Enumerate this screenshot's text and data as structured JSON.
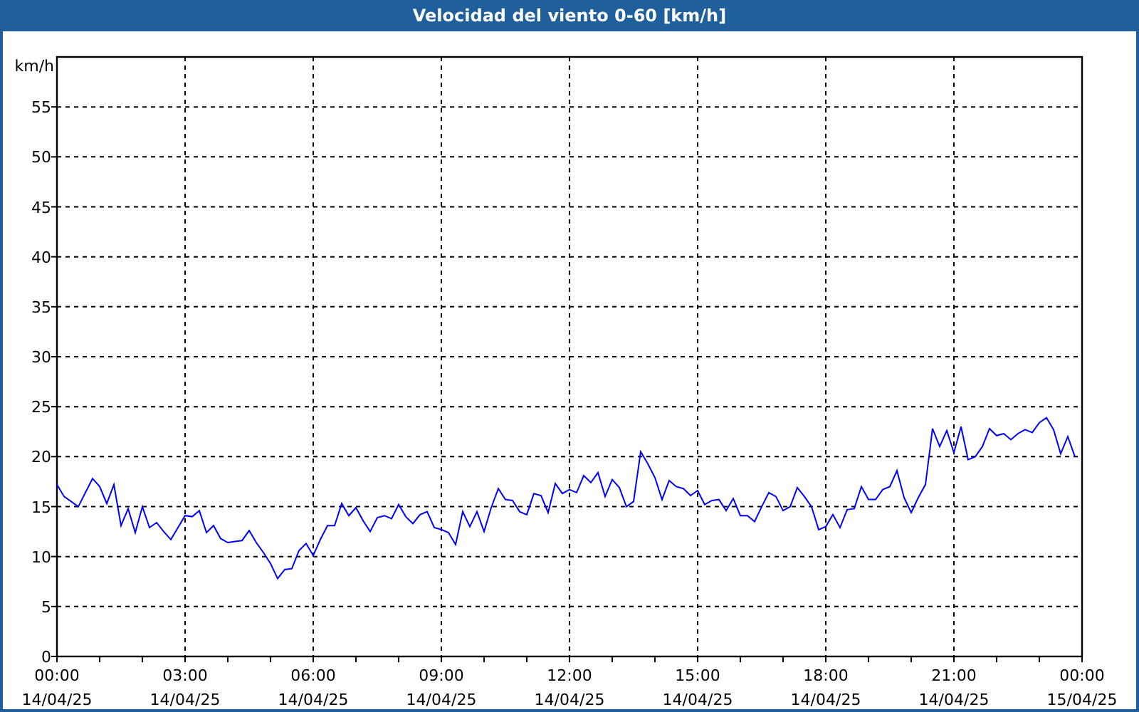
{
  "chart_data": {
    "type": "line",
    "title": "Velocidad del viento 0-60 [km/h]",
    "ylabel": "km/h",
    "categories": [
      "00:00 14/04/25",
      null,
      null,
      null,
      null,
      null,
      null,
      null,
      null,
      null,
      null,
      null,
      null,
      null,
      null,
      null,
      null,
      null,
      "03:00 14/04/25",
      null,
      null,
      null,
      null,
      null,
      null,
      null,
      null,
      null,
      null,
      null,
      null,
      null,
      null,
      null,
      null,
      null,
      "06:00 14/04/25",
      null,
      null,
      null,
      null,
      null,
      null,
      null,
      null,
      null,
      null,
      null,
      null,
      null,
      null,
      null,
      null,
      null,
      "09:00 14/04/25",
      null,
      null,
      null,
      null,
      null,
      null,
      null,
      null,
      null,
      null,
      null,
      null,
      null,
      null,
      null,
      null,
      null,
      "12:00 14/04/25",
      null,
      null,
      null,
      null,
      null,
      null,
      null,
      null,
      null,
      null,
      null,
      null,
      null,
      null,
      null,
      null,
      null,
      "15:00 14/04/25",
      null,
      null,
      null,
      null,
      null,
      null,
      null,
      null,
      null,
      null,
      null,
      null,
      null,
      null,
      null,
      null,
      null,
      "18:00 14/04/25",
      null,
      null,
      null,
      null,
      null,
      null,
      null,
      null,
      null,
      null,
      null,
      null,
      null,
      null,
      null,
      null,
      null,
      "21:00 14/04/25",
      null,
      null,
      null,
      null,
      null,
      null,
      null,
      null,
      null,
      null,
      null,
      null,
      null,
      null,
      null,
      null,
      null,
      "00:00 15/04/25"
    ],
    "series": [
      {
        "color": "#0000ff",
        "values": [
          17.2,
          16.0,
          15.5,
          15.0,
          16.4,
          17.8,
          17.0,
          15.3,
          17.2,
          13.1,
          14.8,
          12.4,
          15.0,
          12.9,
          13.4,
          12.5,
          11.7,
          12.9,
          14.1,
          14.0,
          14.6,
          12.4,
          13.1,
          11.8,
          11.4,
          11.5,
          11.6,
          12.6,
          11.4,
          10.4,
          9.3,
          7.8,
          8.7,
          8.8,
          10.6,
          11.3,
          10.1,
          11.7,
          13.1,
          13.1,
          15.3,
          14.1,
          14.9,
          13.6,
          12.5,
          13.9,
          14.1,
          13.8,
          15.2,
          14.0,
          13.3,
          14.2,
          14.5,
          12.9,
          12.7,
          12.4,
          11.2,
          14.5,
          13.0,
          14.5,
          12.5,
          14.9,
          16.8,
          15.7,
          15.6,
          14.5,
          14.2,
          16.3,
          16.1,
          14.4,
          17.3,
          16.3,
          16.7,
          16.4,
          18.1,
          17.4,
          18.4,
          16.0,
          17.7,
          16.9,
          15.0,
          15.5,
          20.5,
          19.3,
          17.9,
          15.7,
          17.6,
          17.0,
          16.8,
          16.1,
          16.6,
          15.2,
          15.6,
          15.7,
          14.6,
          15.8,
          14.1,
          14.1,
          13.5,
          15.0,
          16.4,
          16.0,
          14.6,
          15.0,
          16.9,
          16.0,
          15.0,
          12.7,
          13.0,
          14.2,
          12.9,
          14.7,
          14.8,
          17.0,
          15.7,
          15.7,
          16.7,
          17.0,
          18.6,
          15.9,
          14.4,
          15.9,
          17.2,
          22.8,
          21.0,
          22.6,
          20.4,
          23.0,
          19.7,
          20.0,
          21.0,
          22.8,
          22.1,
          22.3,
          21.7,
          22.3,
          22.7,
          22.4,
          23.4,
          23.9,
          22.7,
          20.3,
          22.0,
          20.0,
          null
        ]
      }
    ],
    "ylim": [
      0,
      60
    ],
    "grid": true,
    "yticks": [
      0,
      5,
      10,
      15,
      20,
      25,
      30,
      35,
      40,
      45,
      50,
      55
    ]
  }
}
